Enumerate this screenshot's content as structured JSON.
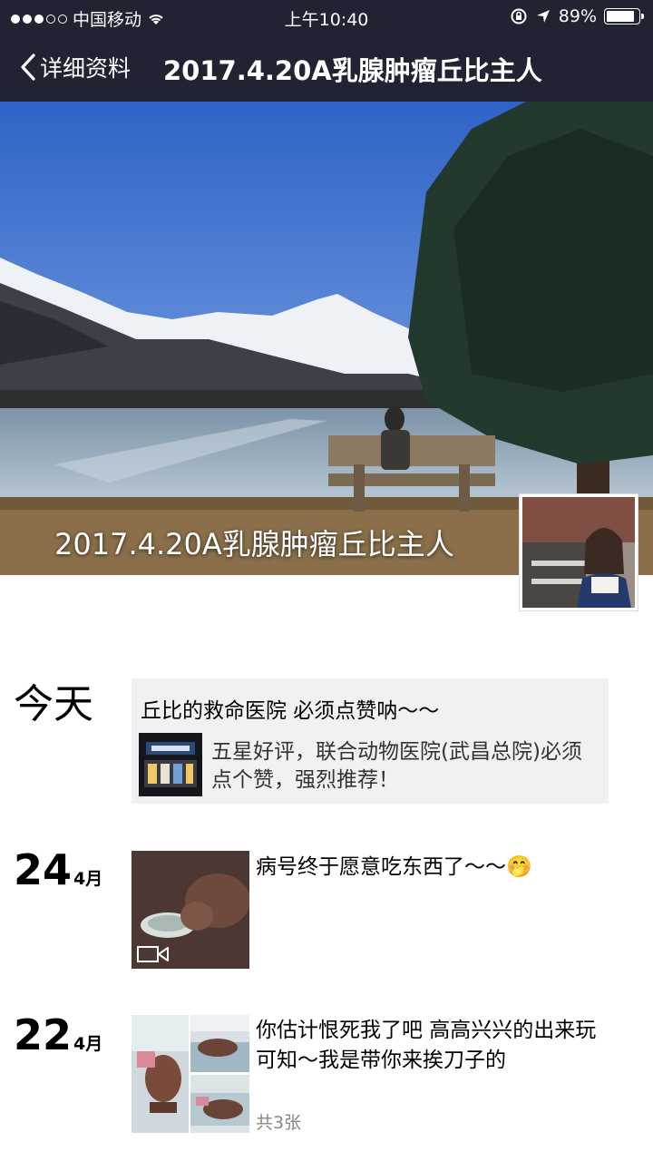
{
  "status_bar": {
    "carrier": "中国移动",
    "time": "上午10:40",
    "battery": "89%",
    "battery_level": 0.89
  },
  "nav": {
    "back_label": "详细资料",
    "title": "2017.4.20A乳腺肿瘤丘比主人"
  },
  "cover": {
    "name": "2017.4.20A乳腺肿瘤丘比主人"
  },
  "timeline": [
    {
      "day": "今天",
      "title": "丘比的救命医院 必须点赞呐～～",
      "share_desc": "五星好评，联合动物医院(武昌总院)必须点个赞，强烈推荐！"
    },
    {
      "day": "24",
      "month": "4月",
      "text": "病号终于愿意吃东西了～～🤭"
    },
    {
      "day": "22",
      "month": "4月",
      "text": "你估计恨死我了吧 高高兴兴的出来玩可知～我是带你来挨刀子的",
      "count": "共3张"
    }
  ],
  "icons": {
    "signal": "signal-dots-icon",
    "wifi": "wifi-icon",
    "lock_rotation": "lock-rotation-icon",
    "location": "location-arrow-icon",
    "back": "chevron-left-icon",
    "video": "video-camera-icon"
  }
}
